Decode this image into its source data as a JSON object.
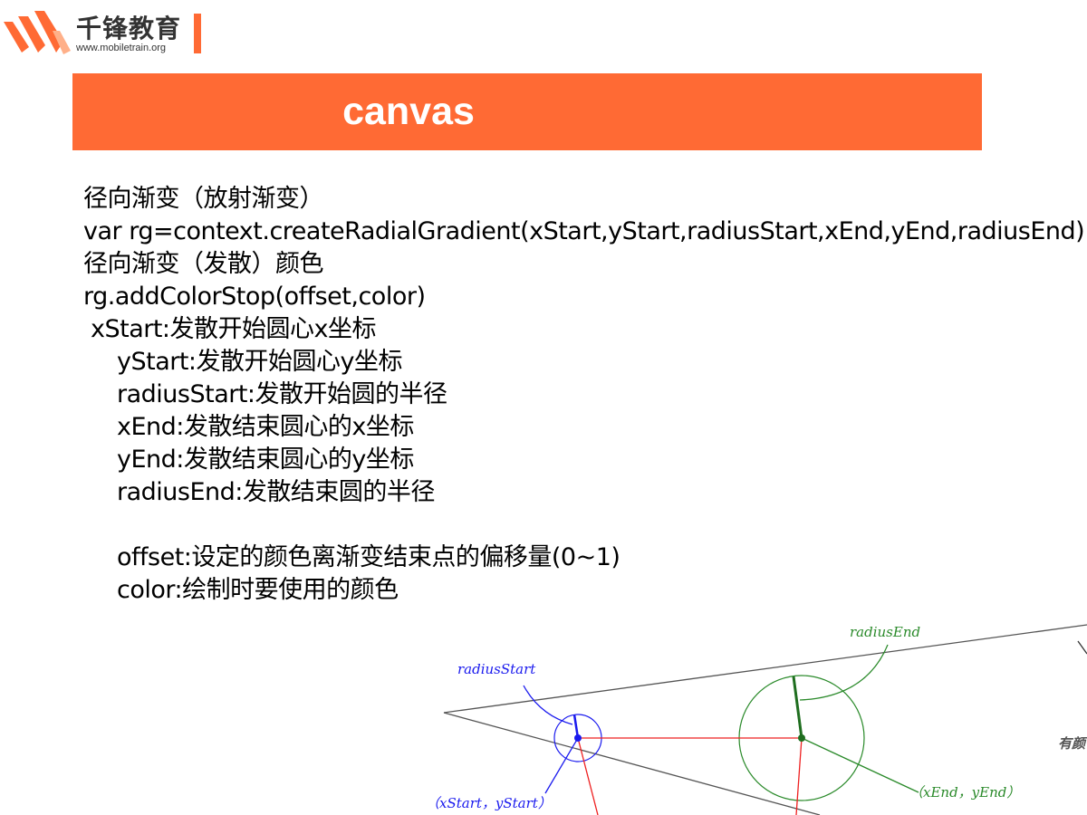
{
  "header": {
    "brand_name": "千锋教育",
    "brand_url": "www.mobiletrain.org",
    "accent_color": "#ff6a34"
  },
  "title": "canvas",
  "body": {
    "lines": [
      "径向渐变（放射渐变）",
      "var rg=context.createRadialGradient(xStart,yStart,radiusStart,xEnd,yEnd,radiusEnd)",
      "径向渐变（发散）颜色",
      "rg.addColorStop(offset,color)",
      "xStart:发散开始圆心x坐标",
      "yStart:发散开始圆心y坐标",
      "radiusStart:发散开始圆的半径",
      "xEnd:发散结束圆心的x坐标",
      "yEnd:发散结束圆心的y坐标",
      "radiusEnd:发散结束圆的半径",
      "offset:设定的颜色离渐变结束点的偏移量(0~1)",
      "color:绘制时要使用的颜色"
    ]
  },
  "diagram": {
    "label_radius_start": "radiusStart",
    "label_radius_end": "radiusEnd",
    "label_start_point": "（xStart，yStart）",
    "label_end_point": "（xEnd，yEnd）",
    "label_cutoff": "有颜",
    "colors": {
      "start": "#1a1aee",
      "end": "#2a8a2a",
      "red": "#ee2020",
      "line": "#555555"
    }
  }
}
